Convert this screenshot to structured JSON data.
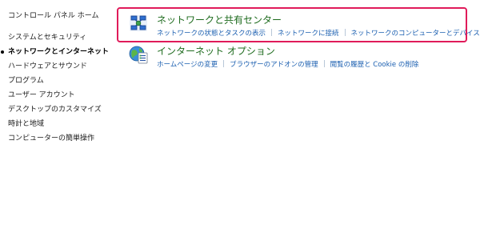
{
  "sidebar": {
    "home": "コントロール パネル ホーム",
    "items": [
      {
        "label": "システムとセキュリティ",
        "active": false
      },
      {
        "label": "ネットワークとインターネット",
        "active": true
      },
      {
        "label": "ハードウェアとサウンド",
        "active": false
      },
      {
        "label": "プログラム",
        "active": false
      },
      {
        "label": "ユーザー アカウント",
        "active": false
      },
      {
        "label": "デスクトップのカスタマイズ",
        "active": false
      },
      {
        "label": "時計と地域",
        "active": false
      },
      {
        "label": "コンピューターの簡単操作",
        "active": false
      }
    ]
  },
  "categories": {
    "network": {
      "title": "ネットワークと共有センター",
      "icon": "network-sharing-center-icon",
      "links": [
        "ネットワークの状態とタスクの表示",
        "ネットワークに接続",
        "ネットワークのコンピューターとデバイスの表示"
      ]
    },
    "internet": {
      "title": "インターネット オプション",
      "icon": "internet-options-icon",
      "links": [
        "ホームページの変更",
        "ブラウザーのアドオンの管理",
        "閲覧の履歴と Cookie の削除"
      ]
    }
  },
  "colors": {
    "highlight": "#e01b5a",
    "category_title": "#1e6b1e",
    "link": "#1b5fb0"
  }
}
